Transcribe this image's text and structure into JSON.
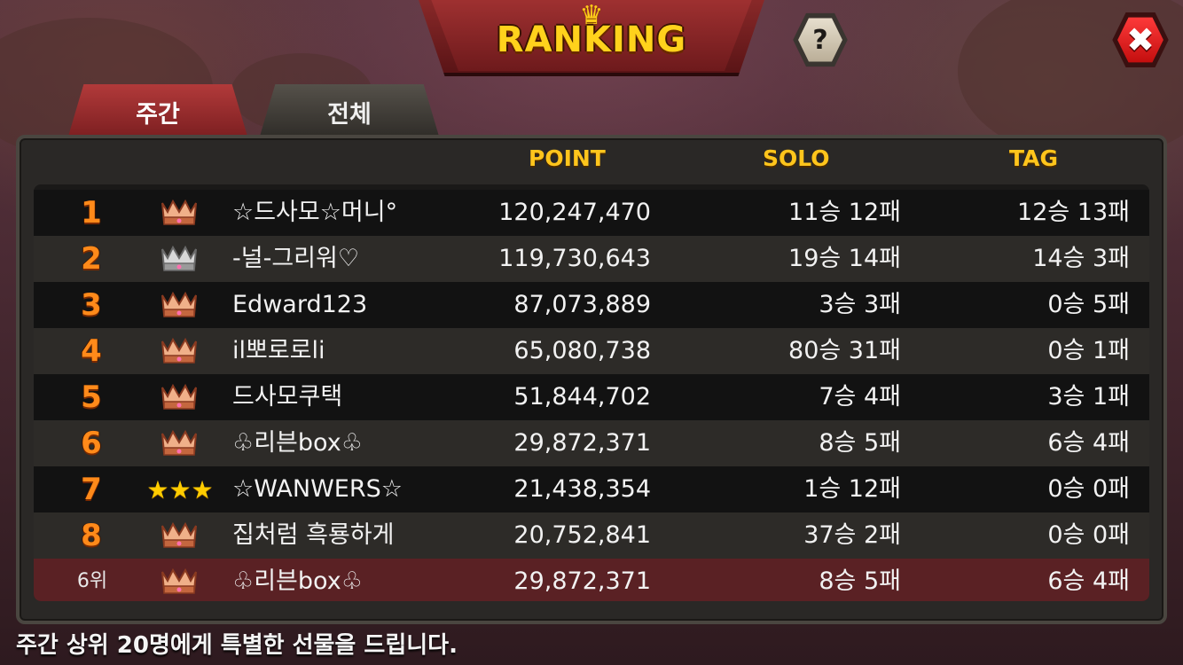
{
  "header": {
    "title": "RANKING",
    "help_label": "?",
    "close_label": "✖"
  },
  "tabs": [
    {
      "label": "주간",
      "active": true
    },
    {
      "label": "전체",
      "active": false
    }
  ],
  "columns": {
    "point": "POINT",
    "solo": "SOLO",
    "tag": "TAG"
  },
  "rows": [
    {
      "rank": "1",
      "badge": "bronze-crown-icon",
      "name": "☆드사모☆머니°",
      "point": "120,247,470",
      "solo": "11승 12패",
      "tag": "12승 13패"
    },
    {
      "rank": "2",
      "badge": "silver-crown-icon",
      "name": "-널-그리워♡",
      "point": "119,730,643",
      "solo": "19승 14패",
      "tag": "14승 3패"
    },
    {
      "rank": "3",
      "badge": "bronze-crown-icon",
      "name": "Edward123",
      "point": "87,073,889",
      "solo": "3승 3패",
      "tag": "0승 5패"
    },
    {
      "rank": "4",
      "badge": "bronze-crown-icon",
      "name": "il뽀로로li",
      "point": "65,080,738",
      "solo": "80승 31패",
      "tag": "0승 1패"
    },
    {
      "rank": "5",
      "badge": "bronze-crown-icon",
      "name": "드사모쿠택",
      "point": "51,844,702",
      "solo": "7승 4패",
      "tag": "3승 1패"
    },
    {
      "rank": "6",
      "badge": "bronze-crown-icon",
      "name": "♧리븐box♧",
      "point": "29,872,371",
      "solo": "8승 5패",
      "tag": "6승 4패"
    },
    {
      "rank": "7",
      "badge": "three-stars-icon",
      "name": "☆WANWERS☆",
      "point": "21,438,354",
      "solo": "1승 12패",
      "tag": "0승 0패"
    },
    {
      "rank": "8",
      "badge": "bronze-crown-icon",
      "name": "집처럼 흑룡하게",
      "point": "20,752,841",
      "solo": "37승 2패",
      "tag": "0승 0패"
    }
  ],
  "my_rank": {
    "rank": "6위",
    "badge": "bronze-crown-icon",
    "name": "♧리븐box♧",
    "point": "29,872,371",
    "solo": "8승 5패",
    "tag": "6승 4패"
  },
  "footer": {
    "message": "주간 상위 20명에게 특별한 선물을 드립니다."
  },
  "colors": {
    "header_gold": "#ffc51c",
    "rank_orange": "#ff8a1a",
    "active_tab": "#b23a3a",
    "my_row": "#5a2124",
    "close_red": "#e01818"
  }
}
